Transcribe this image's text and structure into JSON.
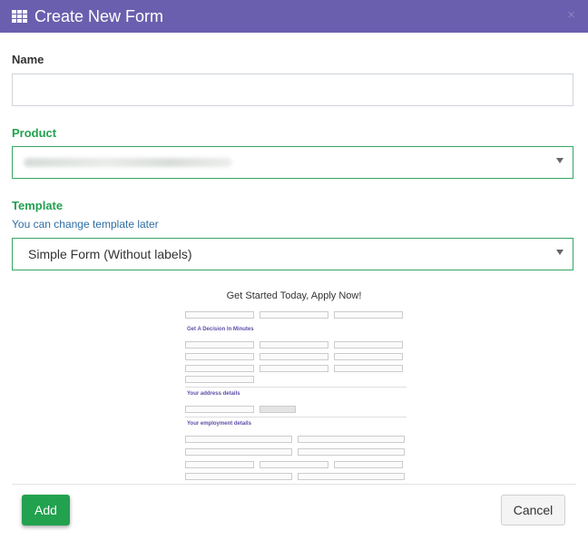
{
  "dialog": {
    "title": "Create New Form",
    "close_glyph": "×",
    "icon": "grid-icon"
  },
  "name_field": {
    "label": "Name",
    "value": ""
  },
  "product_field": {
    "label": "Product",
    "value": ""
  },
  "template_field": {
    "label": "Template",
    "hint": "You can change template later",
    "value": "Simple Form (Without labels)"
  },
  "preview": {
    "title": "Get Started Today, Apply Now!",
    "sections": [
      "Get A Decision In Minutes",
      "Your address details",
      "Your employment details"
    ]
  },
  "buttons": {
    "add": "Add",
    "cancel": "Cancel"
  },
  "colors": {
    "titlebar": "#6a5fae",
    "accent_green": "#22a14f",
    "hint_blue": "#2e6da4"
  }
}
